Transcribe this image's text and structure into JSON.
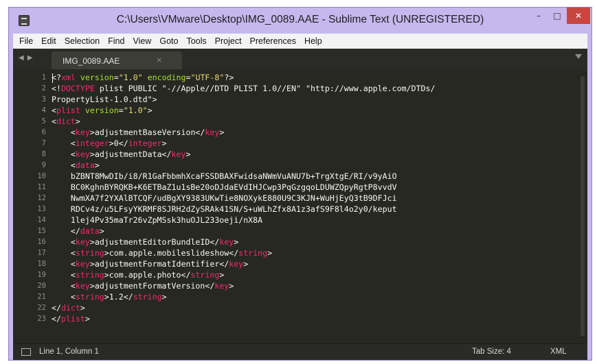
{
  "window": {
    "title": "C:\\Users\\VMware\\Desktop\\IMG_0089.AAE - Sublime Text (UNREGISTERED)",
    "min_glyph": "–",
    "max_glyph": "□",
    "close_glyph": "✕"
  },
  "menu": [
    "File",
    "Edit",
    "Selection",
    "Find",
    "View",
    "Goto",
    "Tools",
    "Project",
    "Preferences",
    "Help"
  ],
  "tabbar": {
    "nav_arrows": "◀ ▶",
    "active_tab": "IMG_0089.AAE",
    "close_glyph": "×"
  },
  "editor": {
    "line_numbers": [
      "1",
      "2",
      "3",
      "4",
      "5",
      "6",
      "7",
      "8",
      "9",
      "10",
      "11",
      "12",
      "13",
      "14",
      "15",
      "16",
      "17",
      "18",
      "19",
      "20",
      "21",
      "22",
      "23"
    ],
    "lines": [
      [
        [
          "t",
          "<?"
        ],
        [
          "tag",
          "xml"
        ],
        [
          "t",
          " "
        ],
        [
          "attr",
          "version"
        ],
        [
          "t",
          "="
        ],
        [
          "str",
          "\"1.0\""
        ],
        [
          "t",
          " "
        ],
        [
          "attr",
          "encoding"
        ],
        [
          "t",
          "="
        ],
        [
          "str",
          "\"UTF-8\""
        ],
        [
          "t",
          "?>"
        ]
      ],
      [
        [
          "t",
          "<!"
        ],
        [
          "tag",
          "DOCTYPE"
        ],
        [
          "t",
          " plist PUBLIC \"-//Apple//DTD PLIST 1.0//EN\" \"http://www.apple.com/DTDs/"
        ]
      ],
      [
        [
          "t",
          "PropertyList-1.0.dtd\">"
        ]
      ],
      [
        [
          "t",
          "<"
        ],
        [
          "tag",
          "plist"
        ],
        [
          "t",
          " "
        ],
        [
          "attr",
          "version"
        ],
        [
          "t",
          "="
        ],
        [
          "str",
          "\"1.0\""
        ],
        [
          "t",
          ">"
        ]
      ],
      [
        [
          "t",
          "<"
        ],
        [
          "tag",
          "dict"
        ],
        [
          "t",
          ">"
        ]
      ],
      [
        [
          "t",
          "    <"
        ],
        [
          "tag",
          "key"
        ],
        [
          "t",
          ">adjustmentBaseVersion</"
        ],
        [
          "tag",
          "key"
        ],
        [
          "t",
          ">"
        ]
      ],
      [
        [
          "t",
          "    <"
        ],
        [
          "tag",
          "integer"
        ],
        [
          "t",
          ">0</"
        ],
        [
          "tag",
          "integer"
        ],
        [
          "t",
          ">"
        ]
      ],
      [
        [
          "t",
          "    <"
        ],
        [
          "tag",
          "key"
        ],
        [
          "t",
          ">adjustmentData</"
        ],
        [
          "tag",
          "key"
        ],
        [
          "t",
          ">"
        ]
      ],
      [
        [
          "t",
          "    <"
        ],
        [
          "tag",
          "data"
        ],
        [
          "t",
          ">"
        ]
      ],
      [
        [
          "t",
          "    bZBNT8MwDIb/i8/R1GaFbbmhXcaFSSDBAXFwidsaNWmVuANU7b+TrgXtgE/RI/v9yAiO"
        ]
      ],
      [
        [
          "t",
          "    BC0KghnBYRQKB+K6ETBaZ1u1sBe20oDJdaEVdIHJCwp3PqGzgqoLDUWZQpyRgtP8vvdV"
        ]
      ],
      [
        [
          "t",
          "    NwmXA7f2YXAlBTCQF/udBgXY9383UKwTie8NOXykE880U9C3KJN+WuHjEyQ3tB9DFJci"
        ]
      ],
      [
        [
          "t",
          "    RDCv4z/u5LFsyYKRMF8SJRH2dZySRAk41SN/S+uWLhZfx8A1z3afS9F8l4o2y0/keput"
        ]
      ],
      [
        [
          "t",
          "    1lej4Pv35maTr26vZpMSsk3huOJL233oeji/nX8A"
        ]
      ],
      [
        [
          "t",
          "    </"
        ],
        [
          "tag",
          "data"
        ],
        [
          "t",
          ">"
        ]
      ],
      [
        [
          "t",
          "    <"
        ],
        [
          "tag",
          "key"
        ],
        [
          "t",
          ">adjustmentEditorBundleID</"
        ],
        [
          "tag",
          "key"
        ],
        [
          "t",
          ">"
        ]
      ],
      [
        [
          "t",
          "    <"
        ],
        [
          "tag",
          "string"
        ],
        [
          "t",
          ">com.apple.mobileslideshow</"
        ],
        [
          "tag",
          "string"
        ],
        [
          "t",
          ">"
        ]
      ],
      [
        [
          "t",
          "    <"
        ],
        [
          "tag",
          "key"
        ],
        [
          "t",
          ">adjustmentFormatIdentifier</"
        ],
        [
          "tag",
          "key"
        ],
        [
          "t",
          ">"
        ]
      ],
      [
        [
          "t",
          "    <"
        ],
        [
          "tag",
          "string"
        ],
        [
          "t",
          ">com.apple.photo</"
        ],
        [
          "tag",
          "string"
        ],
        [
          "t",
          ">"
        ]
      ],
      [
        [
          "t",
          "    <"
        ],
        [
          "tag",
          "key"
        ],
        [
          "t",
          ">adjustmentFormatVersion</"
        ],
        [
          "tag",
          "key"
        ],
        [
          "t",
          ">"
        ]
      ],
      [
        [
          "t",
          "    <"
        ],
        [
          "tag",
          "string"
        ],
        [
          "t",
          ">1.2</"
        ],
        [
          "tag",
          "string"
        ],
        [
          "t",
          ">"
        ]
      ],
      [
        [
          "t",
          "</"
        ],
        [
          "tag",
          "dict"
        ],
        [
          "t",
          ">"
        ]
      ],
      [
        [
          "t",
          "</"
        ],
        [
          "tag",
          "plist"
        ],
        [
          "t",
          ">"
        ]
      ],
      [
        [
          "t",
          ""
        ]
      ]
    ]
  },
  "status": {
    "position": "Line 1, Column 1",
    "tab_size": "Tab Size: 4",
    "syntax": "XML"
  },
  "colors": {
    "tag": "#f92672",
    "attr": "#a6e22e",
    "string": "#e6db74",
    "text": "#f8f8f2",
    "background": "#272822"
  }
}
